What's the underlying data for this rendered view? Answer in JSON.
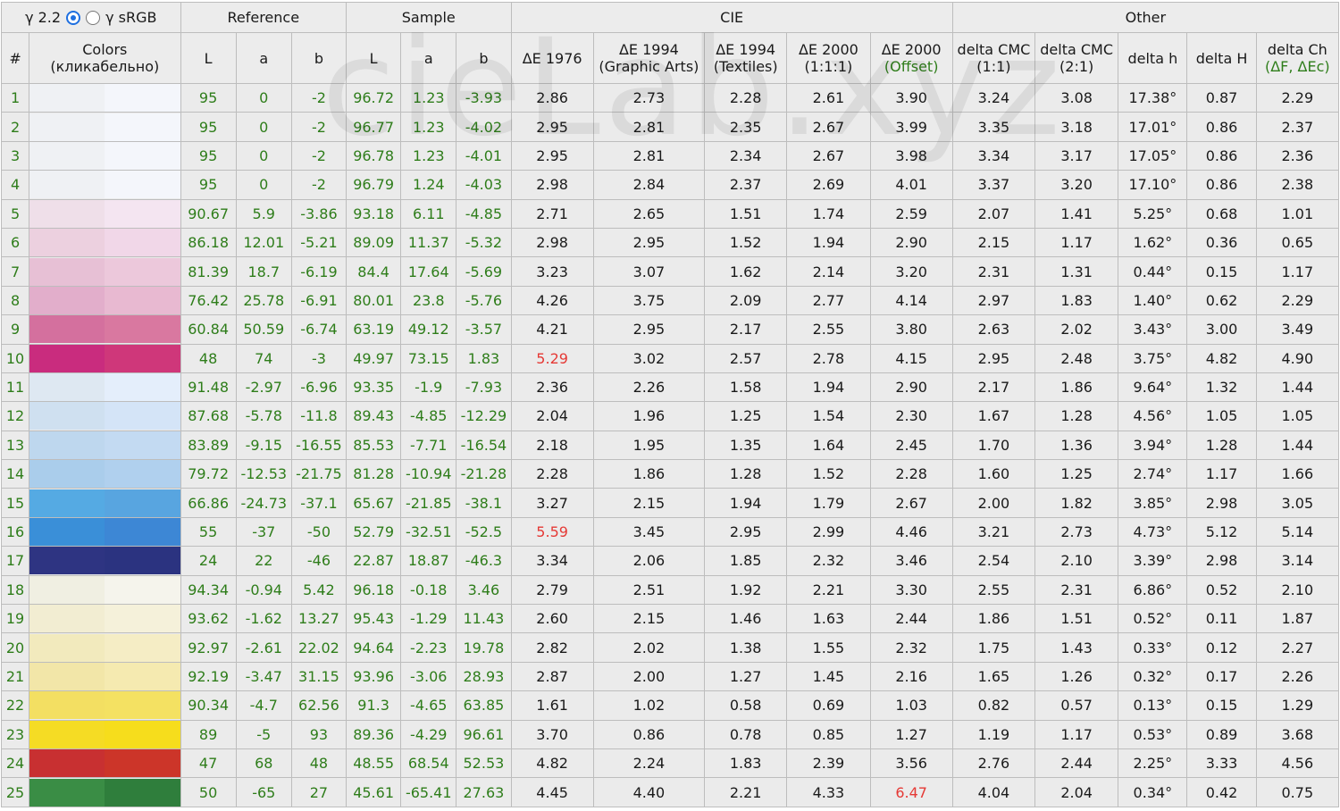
{
  "controls": {
    "gamma_22_label": "γ 2.2",
    "gamma_srgb_label": "γ sRGB",
    "selected": "gamma_22"
  },
  "watermark": "cieLab.xyz",
  "groups": {
    "reference": "Reference",
    "sample": "Sample",
    "cie": "CIE",
    "other": "Other"
  },
  "columns": {
    "num": "#",
    "colors": [
      "Colors",
      "(кликабельно)"
    ],
    "ref_L": "L",
    "ref_a": "a",
    "ref_b": "b",
    "sam_L": "L",
    "sam_a": "a",
    "sam_b": "b",
    "de1976": [
      "ΔE 1976"
    ],
    "de1994ga": [
      "ΔE 1994",
      "(Graphic Arts)"
    ],
    "de1994t": [
      "ΔE 1994",
      "(Textiles)"
    ],
    "de2000": [
      "ΔE 2000",
      "(1:1:1)"
    ],
    "de2000o": [
      "ΔE 2000",
      "(Offset)"
    ],
    "cmc11": [
      "delta CMC",
      "(1:1)"
    ],
    "cmc21": [
      "delta CMC",
      "(2:1)"
    ],
    "dh": [
      "delta h"
    ],
    "dH": [
      "delta H"
    ],
    "dCh": [
      "delta Ch",
      "(ΔF, ΔEc)"
    ]
  },
  "rows": [
    {
      "n": "1",
      "ref": [
        "95",
        "0",
        "-2"
      ],
      "sam": [
        "96.72",
        "1.23",
        "-3.93"
      ],
      "de": [
        "2.86",
        "2.73",
        "2.28",
        "2.61",
        "3.90"
      ],
      "oth": [
        "3.24",
        "3.08",
        "17.38°",
        "0.87",
        "2.29"
      ],
      "c1": "#eff1f4",
      "c2": "#f4f6fb"
    },
    {
      "n": "2",
      "ref": [
        "95",
        "0",
        "-2"
      ],
      "sam": [
        "96.77",
        "1.23",
        "-4.02"
      ],
      "de": [
        "2.95",
        "2.81",
        "2.35",
        "2.67",
        "3.99"
      ],
      "oth": [
        "3.35",
        "3.18",
        "17.01°",
        "0.86",
        "2.37"
      ],
      "c1": "#eff1f4",
      "c2": "#f4f6fb"
    },
    {
      "n": "3",
      "ref": [
        "95",
        "0",
        "-2"
      ],
      "sam": [
        "96.78",
        "1.23",
        "-4.01"
      ],
      "de": [
        "2.95",
        "2.81",
        "2.34",
        "2.67",
        "3.98"
      ],
      "oth": [
        "3.34",
        "3.17",
        "17.05°",
        "0.86",
        "2.36"
      ],
      "c1": "#eff1f4",
      "c2": "#f4f6fb"
    },
    {
      "n": "4",
      "ref": [
        "95",
        "0",
        "-2"
      ],
      "sam": [
        "96.79",
        "1.24",
        "-4.03"
      ],
      "de": [
        "2.98",
        "2.84",
        "2.37",
        "2.69",
        "4.01"
      ],
      "oth": [
        "3.37",
        "3.20",
        "17.10°",
        "0.86",
        "2.38"
      ],
      "c1": "#eff1f4",
      "c2": "#f4f6fb"
    },
    {
      "n": "5",
      "ref": [
        "90.67",
        "5.9",
        "-3.86"
      ],
      "sam": [
        "93.18",
        "6.11",
        "-4.85"
      ],
      "de": [
        "2.71",
        "2.65",
        "1.51",
        "1.74",
        "2.59"
      ],
      "oth": [
        "2.07",
        "1.41",
        "5.25°",
        "0.68",
        "1.01"
      ],
      "c1": "#efdfe9",
      "c2": "#f4e5f1"
    },
    {
      "n": "6",
      "ref": [
        "86.18",
        "12.01",
        "-5.21"
      ],
      "sam": [
        "89.09",
        "11.37",
        "-5.32"
      ],
      "de": [
        "2.98",
        "2.95",
        "1.52",
        "1.94",
        "2.90"
      ],
      "oth": [
        "2.15",
        "1.17",
        "1.62°",
        "0.36",
        "0.65"
      ],
      "c1": "#ecd0df",
      "c2": "#f1d7e8"
    },
    {
      "n": "7",
      "ref": [
        "81.39",
        "18.7",
        "-6.19"
      ],
      "sam": [
        "84.4",
        "17.64",
        "-5.69"
      ],
      "de": [
        "3.23",
        "3.07",
        "1.62",
        "2.14",
        "3.20"
      ],
      "oth": [
        "2.31",
        "1.31",
        "0.44°",
        "0.15",
        "1.17"
      ],
      "c1": "#e7c0d5",
      "c2": "#ecc8db"
    },
    {
      "n": "8",
      "ref": [
        "76.42",
        "25.78",
        "-6.91"
      ],
      "sam": [
        "80.01",
        "23.8",
        "-5.76"
      ],
      "de": [
        "4.26",
        "3.75",
        "2.09",
        "2.77",
        "4.14"
      ],
      "oth": [
        "2.97",
        "1.83",
        "1.40°",
        "0.62",
        "2.29"
      ],
      "c1": "#e2aecb",
      "c2": "#e8b9d1"
    },
    {
      "n": "9",
      "ref": [
        "60.84",
        "50.59",
        "-6.74"
      ],
      "sam": [
        "63.19",
        "49.12",
        "-3.57"
      ],
      "de": [
        "4.21",
        "2.95",
        "2.17",
        "2.55",
        "3.80"
      ],
      "oth": [
        "2.63",
        "2.02",
        "3.43°",
        "3.00",
        "3.49"
      ],
      "c1": "#d4709e",
      "c2": "#d978a0"
    },
    {
      "n": "10",
      "ref": [
        "48",
        "74",
        "-3"
      ],
      "sam": [
        "49.97",
        "73.15",
        "1.83"
      ],
      "de": [
        "5.29",
        "3.02",
        "2.57",
        "2.78",
        "4.15"
      ],
      "oth": [
        "2.95",
        "2.48",
        "3.75°",
        "4.82",
        "4.90"
      ],
      "c1": "#c92c7e",
      "c2": "#cf377a"
    },
    {
      "n": "11",
      "ref": [
        "91.48",
        "-2.97",
        "-6.96"
      ],
      "sam": [
        "93.35",
        "-1.9",
        "-7.93"
      ],
      "de": [
        "2.36",
        "2.26",
        "1.58",
        "1.94",
        "2.90"
      ],
      "oth": [
        "2.17",
        "1.86",
        "9.64°",
        "1.32",
        "1.44"
      ],
      "c1": "#dee8f2",
      "c2": "#e4eefb"
    },
    {
      "n": "12",
      "ref": [
        "87.68",
        "-5.78",
        "-11.8"
      ],
      "sam": [
        "89.43",
        "-4.85",
        "-12.29"
      ],
      "de": [
        "2.04",
        "1.96",
        "1.25",
        "1.54",
        "2.30"
      ],
      "oth": [
        "1.67",
        "1.28",
        "4.56°",
        "1.05",
        "1.05"
      ],
      "c1": "#cfe0f0",
      "c2": "#d4e4f7"
    },
    {
      "n": "13",
      "ref": [
        "83.89",
        "-9.15",
        "-16.55"
      ],
      "sam": [
        "85.53",
        "-7.71",
        "-16.54"
      ],
      "de": [
        "2.18",
        "1.95",
        "1.35",
        "1.64",
        "2.45"
      ],
      "oth": [
        "1.70",
        "1.36",
        "3.94°",
        "1.28",
        "1.44"
      ],
      "c1": "#bed7ee",
      "c2": "#c3daf2"
    },
    {
      "n": "14",
      "ref": [
        "79.72",
        "-12.53",
        "-21.75"
      ],
      "sam": [
        "81.28",
        "-10.94",
        "-21.28"
      ],
      "de": [
        "2.28",
        "1.86",
        "1.28",
        "1.52",
        "2.28"
      ],
      "oth": [
        "1.60",
        "1.25",
        "2.74°",
        "1.17",
        "1.66"
      ],
      "c1": "#aacdeb",
      "c2": "#b0d0ee"
    },
    {
      "n": "15",
      "ref": [
        "66.86",
        "-24.73",
        "-37.1"
      ],
      "sam": [
        "65.67",
        "-21.85",
        "-38.1"
      ],
      "de": [
        "3.27",
        "2.15",
        "1.94",
        "1.79",
        "2.67"
      ],
      "oth": [
        "2.00",
        "1.82",
        "3.85°",
        "2.98",
        "3.05"
      ],
      "c1": "#55aae3",
      "c2": "#58a5e0"
    },
    {
      "n": "16",
      "ref": [
        "55",
        "-37",
        "-50"
      ],
      "sam": [
        "52.79",
        "-32.51",
        "-52.5"
      ],
      "de": [
        "5.59",
        "3.45",
        "2.95",
        "2.99",
        "4.46"
      ],
      "oth": [
        "3.21",
        "2.73",
        "4.73°",
        "5.12",
        "5.14"
      ],
      "c1": "#3a8fd8",
      "c2": "#3d87d5"
    },
    {
      "n": "17",
      "ref": [
        "24",
        "22",
        "-46"
      ],
      "sam": [
        "22.87",
        "18.87",
        "-46.3"
      ],
      "de": [
        "3.34",
        "2.06",
        "1.85",
        "2.32",
        "3.46"
      ],
      "oth": [
        "2.54",
        "2.10",
        "3.39°",
        "2.98",
        "3.14"
      ],
      "c1": "#2e3482",
      "c2": "#2b3380"
    },
    {
      "n": "18",
      "ref": [
        "94.34",
        "-0.94",
        "5.42"
      ],
      "sam": [
        "96.18",
        "-0.18",
        "3.46"
      ],
      "de": [
        "2.79",
        "2.51",
        "1.92",
        "2.21",
        "3.30"
      ],
      "oth": [
        "2.55",
        "2.31",
        "6.86°",
        "0.52",
        "2.10"
      ],
      "c1": "#f0efe2",
      "c2": "#f5f4ec"
    },
    {
      "n": "19",
      "ref": [
        "93.62",
        "-1.62",
        "13.27"
      ],
      "sam": [
        "95.43",
        "-1.29",
        "11.43"
      ],
      "de": [
        "2.60",
        "2.15",
        "1.46",
        "1.63",
        "2.44"
      ],
      "oth": [
        "1.86",
        "1.51",
        "0.52°",
        "0.11",
        "1.87"
      ],
      "c1": "#f2edd2",
      "c2": "#f5f1da"
    },
    {
      "n": "20",
      "ref": [
        "92.97",
        "-2.61",
        "22.02"
      ],
      "sam": [
        "94.64",
        "-2.23",
        "19.78"
      ],
      "de": [
        "2.82",
        "2.02",
        "1.38",
        "1.55",
        "2.32"
      ],
      "oth": [
        "1.75",
        "1.43",
        "0.33°",
        "0.12",
        "2.27"
      ],
      "c1": "#f2eabd",
      "c2": "#f5edc5"
    },
    {
      "n": "21",
      "ref": [
        "92.19",
        "-3.47",
        "31.15"
      ],
      "sam": [
        "93.96",
        "-3.06",
        "28.93"
      ],
      "de": [
        "2.87",
        "2.00",
        "1.27",
        "1.45",
        "2.16"
      ],
      "oth": [
        "1.65",
        "1.26",
        "0.32°",
        "0.17",
        "2.26"
      ],
      "c1": "#f2e6a8",
      "c2": "#f5eab0"
    },
    {
      "n": "22",
      "ref": [
        "90.34",
        "-4.7",
        "62.56"
      ],
      "sam": [
        "91.3",
        "-4.65",
        "63.85"
      ],
      "de": [
        "1.61",
        "1.02",
        "0.58",
        "0.69",
        "1.03"
      ],
      "oth": [
        "0.82",
        "0.57",
        "0.13°",
        "0.15",
        "1.29"
      ],
      "c1": "#f3df62",
      "c2": "#f4e162"
    },
    {
      "n": "23",
      "ref": [
        "89",
        "-5",
        "93"
      ],
      "sam": [
        "89.36",
        "-4.29",
        "96.61"
      ],
      "de": [
        "3.70",
        "0.86",
        "0.78",
        "0.85",
        "1.27"
      ],
      "oth": [
        "1.19",
        "1.17",
        "0.53°",
        "0.89",
        "3.68"
      ],
      "c1": "#f5dc24",
      "c2": "#f6dd1c"
    },
    {
      "n": "24",
      "ref": [
        "47",
        "68",
        "48"
      ],
      "sam": [
        "48.55",
        "68.54",
        "52.53"
      ],
      "de": [
        "4.82",
        "2.24",
        "1.83",
        "2.39",
        "3.56"
      ],
      "oth": [
        "2.76",
        "2.44",
        "2.25°",
        "3.33",
        "4.56"
      ],
      "c1": "#c83031",
      "c2": "#cc3529"
    },
    {
      "n": "25",
      "ref": [
        "50",
        "-65",
        "27"
      ],
      "sam": [
        "45.61",
        "-65.41",
        "27.63"
      ],
      "de": [
        "4.45",
        "4.40",
        "2.21",
        "4.33",
        "6.47"
      ],
      "oth": [
        "4.04",
        "2.04",
        "0.34°",
        "0.42",
        "0.75"
      ],
      "c1": "#3a8d45",
      "c2": "#2f7e3c"
    }
  ],
  "highlighted_colors": {
    "red": "#e53935",
    "green": "#2e7d1a"
  }
}
